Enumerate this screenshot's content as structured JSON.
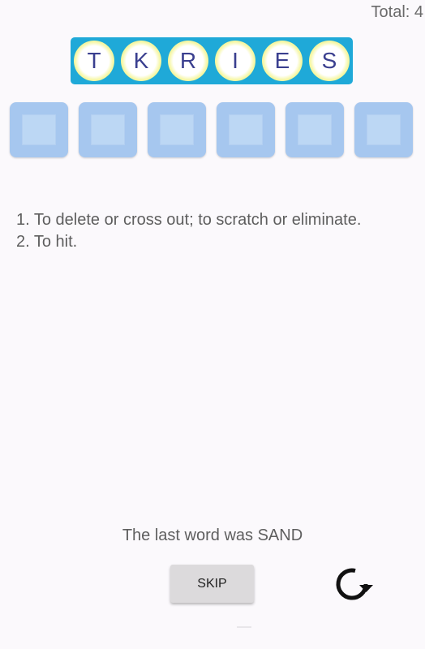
{
  "header": {
    "total": "Total: 4"
  },
  "scrambled_letters": [
    "T",
    "K",
    "R",
    "I",
    "E",
    "S"
  ],
  "answer_slots": [
    "",
    "",
    "",
    "",
    "",
    ""
  ],
  "definitions": [
    "1. To delete or cross out; to scratch or eliminate.",
    "2. To hit."
  ],
  "last_word": "The last word was SAND",
  "controls": {
    "skip_label": "SKIP",
    "refresh_icon": "refresh-icon"
  },
  "colors": {
    "tile_border": "#1fa9d8",
    "tile_glow": "#eef35a",
    "letter": "#3a3f8f",
    "slot": "#a6c7ef"
  }
}
